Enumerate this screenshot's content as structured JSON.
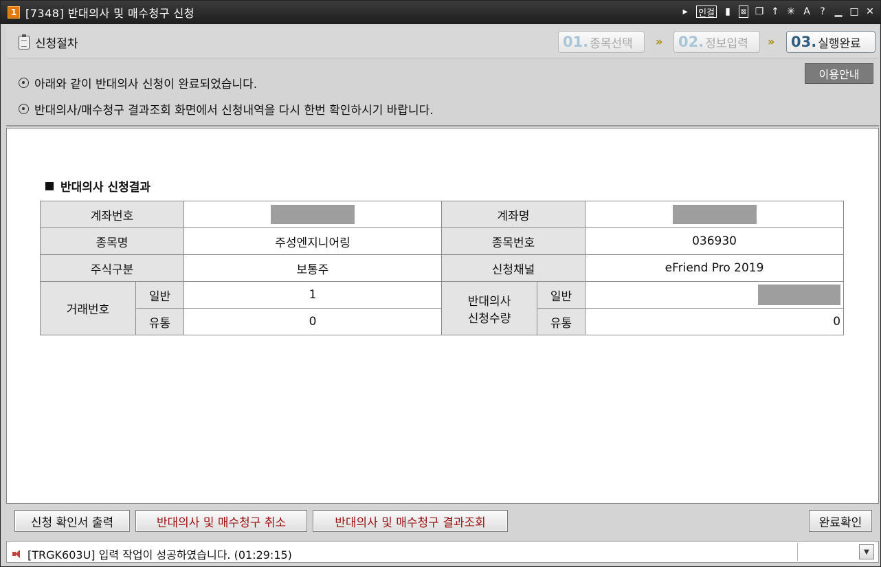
{
  "window": {
    "number": "1",
    "title": "[7348] 반대의사 및 매수청구 신청",
    "tools": {
      "link_label": "인걸",
      "pin": "↑",
      "font": "A",
      "help": "?",
      "minimize": "▁",
      "maximize": "□",
      "close": "✕"
    }
  },
  "steps": {
    "procedure_label": "신청절차",
    "items": [
      {
        "num": "01.",
        "label": "종목선택",
        "state": "inactive"
      },
      {
        "num": "02.",
        "label": "정보입력",
        "state": "inactive"
      },
      {
        "num": "03.",
        "label": "실행완료",
        "state": "active"
      }
    ],
    "separator": "»"
  },
  "info": {
    "lines": [
      "아래와 같이 반대의사 신청이 완료되었습니다.",
      "반대의사/매수청구 결과조회 화면에서 신청내역을 다시 한번 확인하시기 바랍니다."
    ],
    "guide_button": "이용안내"
  },
  "result": {
    "section_title": "반대의사 신청결과",
    "labels": {
      "account_no": "계좌번호",
      "account_name": "계좌명",
      "stock_name": "종목명",
      "stock_code": "종목번호",
      "stock_type": "주식구분",
      "channel": "신청채널",
      "trade_no": "거래번호",
      "general": "일반",
      "circulation": "유통",
      "apply_qty_line1": "반대의사",
      "apply_qty_line2": "신청수량"
    },
    "values": {
      "stock_name": "주성엔지니어링",
      "stock_code": "036930",
      "stock_type": "보통주",
      "channel": "eFriend Pro 2019",
      "trade_general": "1",
      "trade_circulation": "0",
      "qty_circulation": "0"
    }
  },
  "buttons": {
    "print": "신청 확인서 출력",
    "cancel": "반대의사 및 매수청구 취소",
    "inquiry": "반대의사 및 매수청구 결과조회",
    "confirm": "완료확인"
  },
  "status": {
    "message": "[TRGK603U] 입력 작업이 성공하였습니다. (01:29:15)",
    "dropdown": "▼"
  }
}
